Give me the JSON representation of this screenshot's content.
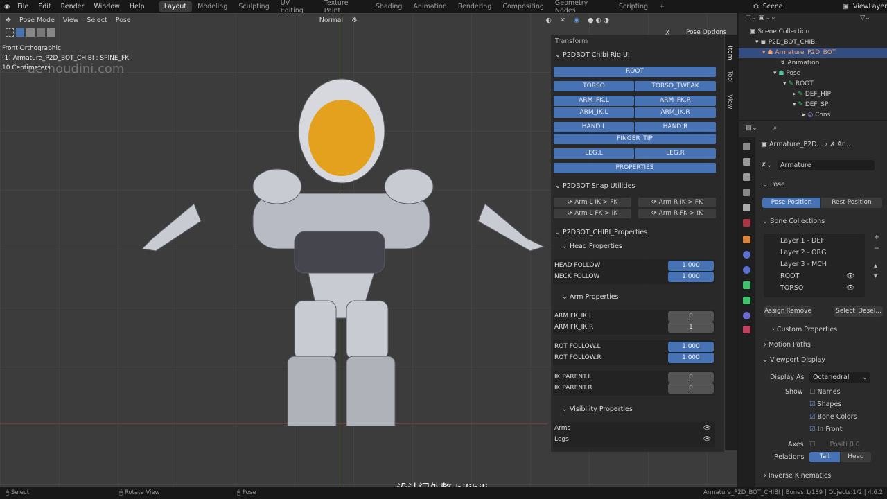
{
  "menu": [
    "File",
    "Edit",
    "Render",
    "Window",
    "Help"
  ],
  "workspaces": [
    "Layout",
    "Modeling",
    "Sculpting",
    "UV Editing",
    "Texture Paint",
    "Shading",
    "Animation",
    "Rendering",
    "Compositing",
    "Geometry Nodes",
    "Scripting",
    "+"
  ],
  "scene": "Scene",
  "view_layer": "ViewLayer",
  "viewport": {
    "mode": "Pose Mode",
    "menus": [
      "View",
      "Select",
      "Pose"
    ],
    "orientation": "Normal",
    "pose_options": "Pose Options",
    "x_mirror": "X",
    "overlay": [
      "Front Orthographic",
      "(1) Armature_P2D_BOT_CHIBI : SPINE_FK",
      "10 Centimeters"
    ],
    "watermark": "ae-houdini.com",
    "subtitle": "设计门外整 bilibili"
  },
  "npanel": {
    "transform": "Transform",
    "rig_title": "P2DBOT Chibi Rig UI",
    "rig_buttons": {
      "root": "ROOT",
      "torso": "TORSO",
      "torso_tweak": "TORSO_TWEAK",
      "arm_fk_l": "ARM_FK.L",
      "arm_fk_r": "ARM_FK.R",
      "arm_ik_l": "ARM_IK.L",
      "arm_ik_r": "ARM_IK.R",
      "hand_l": "HAND.L",
      "hand_r": "HAND.R",
      "finger_tip": "FINGER_TIP",
      "leg_l": "LEG.L",
      "leg_r": "LEG.R",
      "properties": "PROPERTIES"
    },
    "snap_title": "P2DBOT Snap Utilities",
    "snap": [
      "Arm L IK > FK",
      "Arm R IK > FK",
      "Arm L FK > IK",
      "Arm R FK > IK"
    ],
    "props_title": "P2DBOT_CHIBI_Properties",
    "head_title": "Head Properties",
    "head": [
      {
        "label": "HEAD FOLLOW",
        "value": "1.000"
      },
      {
        "label": "NECK FOLLOW",
        "value": "1.000"
      }
    ],
    "arm_title": "Arm Properties",
    "arm_fkik": [
      {
        "label": "ARM FK_IK.L",
        "value": "0"
      },
      {
        "label": "ARM FK_IK.R",
        "value": "1"
      }
    ],
    "rot": [
      {
        "label": "ROT FOLLOW.L",
        "value": "1.000"
      },
      {
        "label": "ROT FOLLOW.R",
        "value": "1.000"
      }
    ],
    "ikp": [
      {
        "label": "IK PARENT.L",
        "value": "0"
      },
      {
        "label": "IK PARENT.R",
        "value": "0"
      }
    ],
    "vis_title": "Visibility Properties",
    "vis": [
      "Arms",
      "Legs"
    ],
    "tabs": [
      "Item",
      "Tool",
      "View"
    ]
  },
  "outliner": {
    "items": [
      "Scene Collection",
      "P2D_BOT_CHIBI",
      "Armature_P2D_BOT",
      "Animation",
      "Pose",
      "ROOT",
      "DEF_HIP",
      "DEF_SPI",
      "Cons"
    ]
  },
  "properties": {
    "breadcrumb": [
      "Armature_P2D...",
      "Ar..."
    ],
    "data_name": "Armature",
    "pose": "Pose",
    "pose_position": "Pose Position",
    "rest_position": "Rest Position",
    "bone_collections": "Bone Collections",
    "collections": [
      "Layer 1 - DEF",
      "Layer 2 - ORG",
      "Layer 3 - MCH",
      "ROOT",
      "TORSO"
    ],
    "assign": "Assign",
    "remove": "Remove",
    "select": "Select",
    "deselect": "Desel...",
    "custom_props": "Custom Properties",
    "motion_paths": "Motion Paths",
    "viewport_display": "Viewport Display",
    "display_as_label": "Display As",
    "display_as": "Octahedral",
    "show": "Show",
    "names": "Names",
    "shapes": "Shapes",
    "bone_colors": "Bone Colors",
    "in_front": "In Front",
    "axes": "Axes",
    "position": "Positi 0.0",
    "relations": "Relations",
    "tail": "Tail",
    "head": "Head",
    "ik": "Inverse Kinematics"
  },
  "status": {
    "select": "Select",
    "rotate": "Rotate View",
    "pose": "Pose",
    "info": "Armature_P2D_BOT_CHIBI | Bones:1/189 | Objects:1/2 | 4.6.2"
  }
}
